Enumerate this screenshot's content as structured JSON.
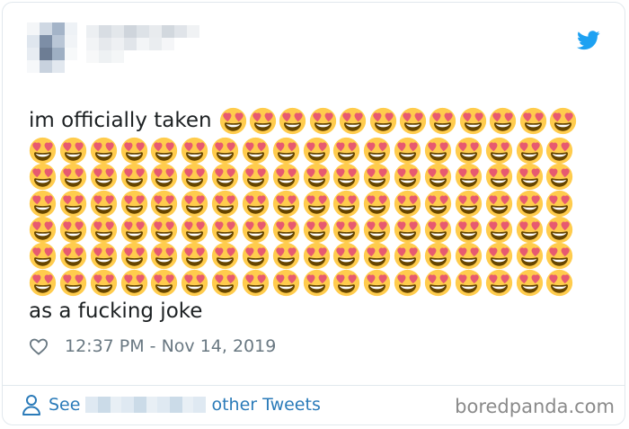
{
  "tweet": {
    "text_line1": "im officially taken",
    "text_last": "as a fucking joke",
    "emoji_first_row_count": 12,
    "emoji_grid_rows": 6,
    "emoji_grid_cols": 18,
    "emoji": "heart-eyes-icon",
    "timestamp": "12:37 PM - Nov 14, 2019"
  },
  "footer": {
    "see_label": "See",
    "tweets_label": "other Tweets"
  },
  "watermark": "boredpanda.com",
  "colors": {
    "link": "#2b7bb9",
    "text": "#1c2022",
    "meta": "#697882",
    "twitter_blue": "#1da1f2"
  }
}
